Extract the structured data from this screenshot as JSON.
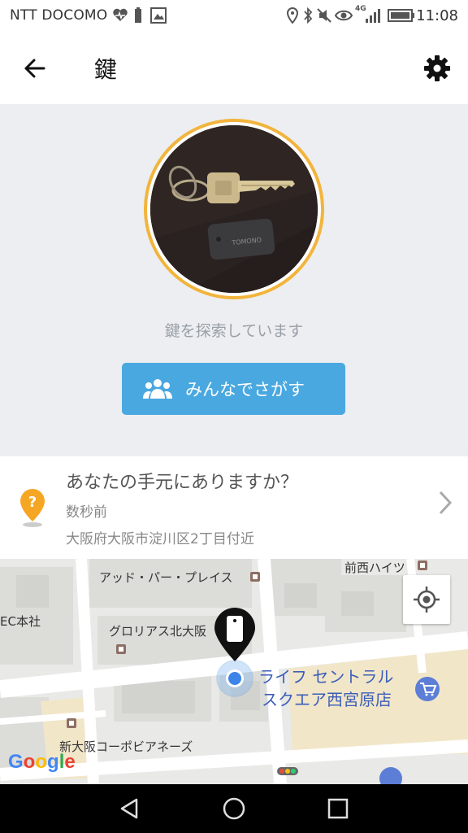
{
  "status_bar": {
    "carrier": "NTT DOCOMO",
    "network": "4G",
    "time": "11:08"
  },
  "app_bar": {
    "title": "鍵",
    "back_icon": "arrow-left-icon",
    "settings_icon": "gear-icon"
  },
  "hero": {
    "photo_alt": "key with tag photo",
    "tag_text": "TOMONO",
    "status_text": "鍵を探索しています",
    "search_button_label": "みんなでさがす",
    "ring_color": "#f2b43c",
    "button_color": "#4aa8e0"
  },
  "info": {
    "question": "あなたの手元にありますか？",
    "time_ago": "数秒前",
    "address": "大阪府大阪市淀川区2丁目付近",
    "pin_color": "#f5a623"
  },
  "map": {
    "labels": {
      "add_par_place": "アッド・パー・プレイス",
      "maenishi_heights": "前西ハイツ",
      "ec_honsha": "EC本社",
      "gloria_kita_osaka": "グロリアス北大阪",
      "life_central_line1": "ライフ セントラル",
      "life_central_line2": "スクエア西宮原店",
      "shin_osaka_corp": "新大阪コーポビアネーズ"
    },
    "google_logo": "Google"
  },
  "nav_bar": {
    "back": "triangle-back-icon",
    "home": "circle-home-icon",
    "recent": "square-recent-icon"
  }
}
